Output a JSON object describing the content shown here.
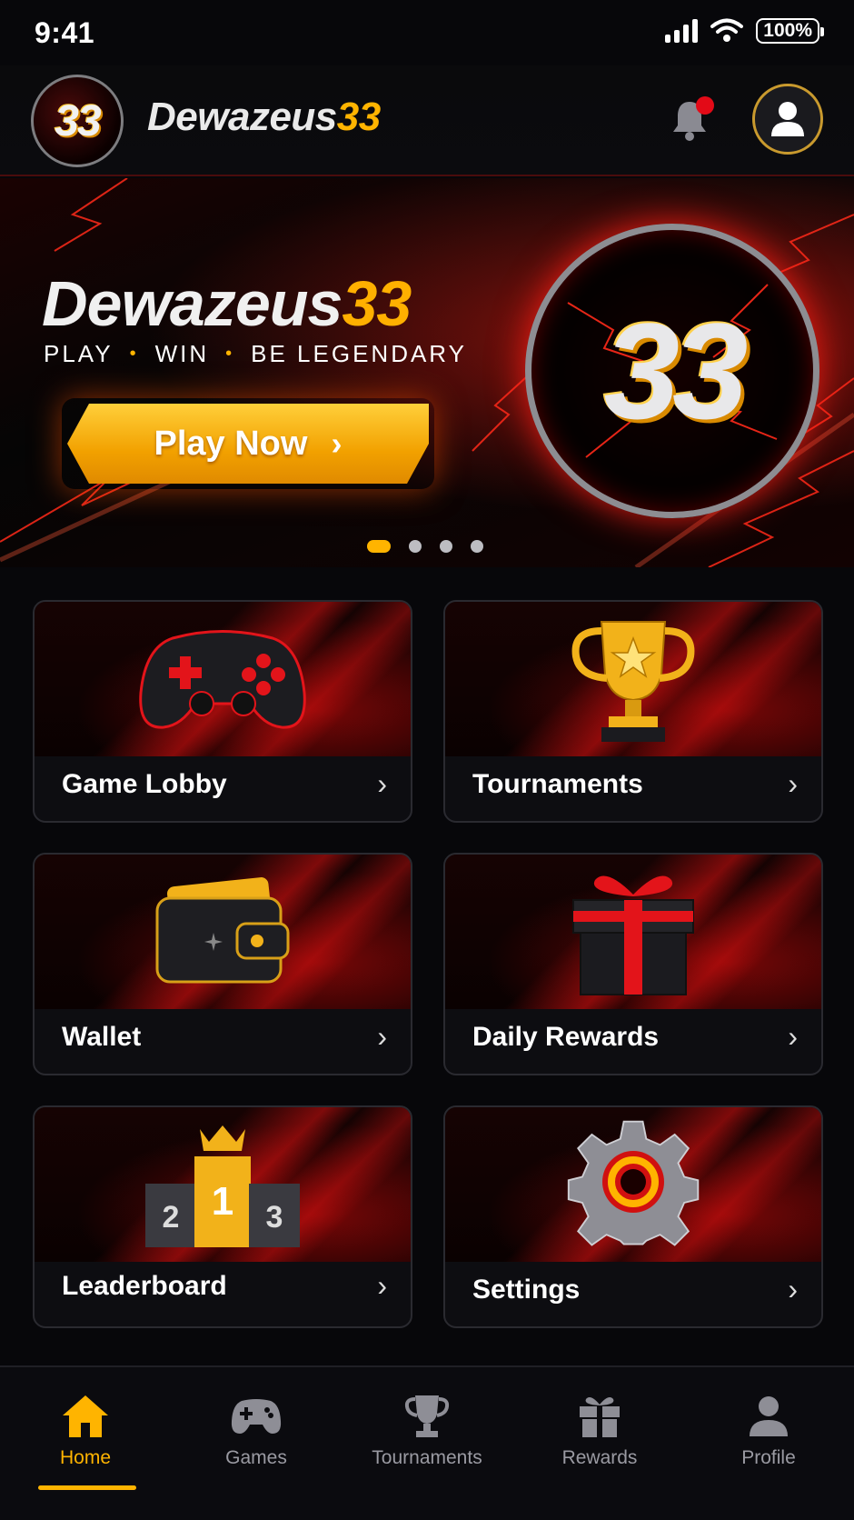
{
  "status_bar": {
    "time": "9:41",
    "battery": "100%"
  },
  "header": {
    "logo_text": "33",
    "brand_white": "Dewazeus",
    "brand_gold": "33"
  },
  "hero": {
    "title_white": "Dewazeus",
    "title_gold": "33",
    "tagline": [
      "PLAY",
      "WIN",
      "BE LEGENDARY"
    ],
    "cta_label": "Play Now",
    "badge_text": "33",
    "carousel_pages": 4,
    "carousel_active": 1
  },
  "menu": [
    {
      "label": "Game Lobby",
      "icon": "gamepad-icon"
    },
    {
      "label": "Tournaments",
      "icon": "trophy-icon"
    },
    {
      "label": "Wallet",
      "icon": "wallet-icon"
    },
    {
      "label": "Daily Rewards",
      "icon": "gift-icon"
    },
    {
      "label": "Leaderboard",
      "icon": "podium-icon",
      "podium": [
        "2",
        "1",
        "3"
      ]
    },
    {
      "label": "Settings",
      "icon": "gear-icon"
    }
  ],
  "bottom_nav": [
    {
      "label": "Home",
      "icon": "home-icon",
      "active": true
    },
    {
      "label": "Games",
      "icon": "gamepad-icon",
      "active": false
    },
    {
      "label": "Tournaments",
      "icon": "trophy-icon",
      "active": false
    },
    {
      "label": "Rewards",
      "icon": "gift-icon",
      "active": false
    },
    {
      "label": "Profile",
      "icon": "user-icon",
      "active": false
    }
  ],
  "colors": {
    "accent": "#ffb400",
    "brand_red": "#e30a17",
    "background": "#07070a"
  }
}
